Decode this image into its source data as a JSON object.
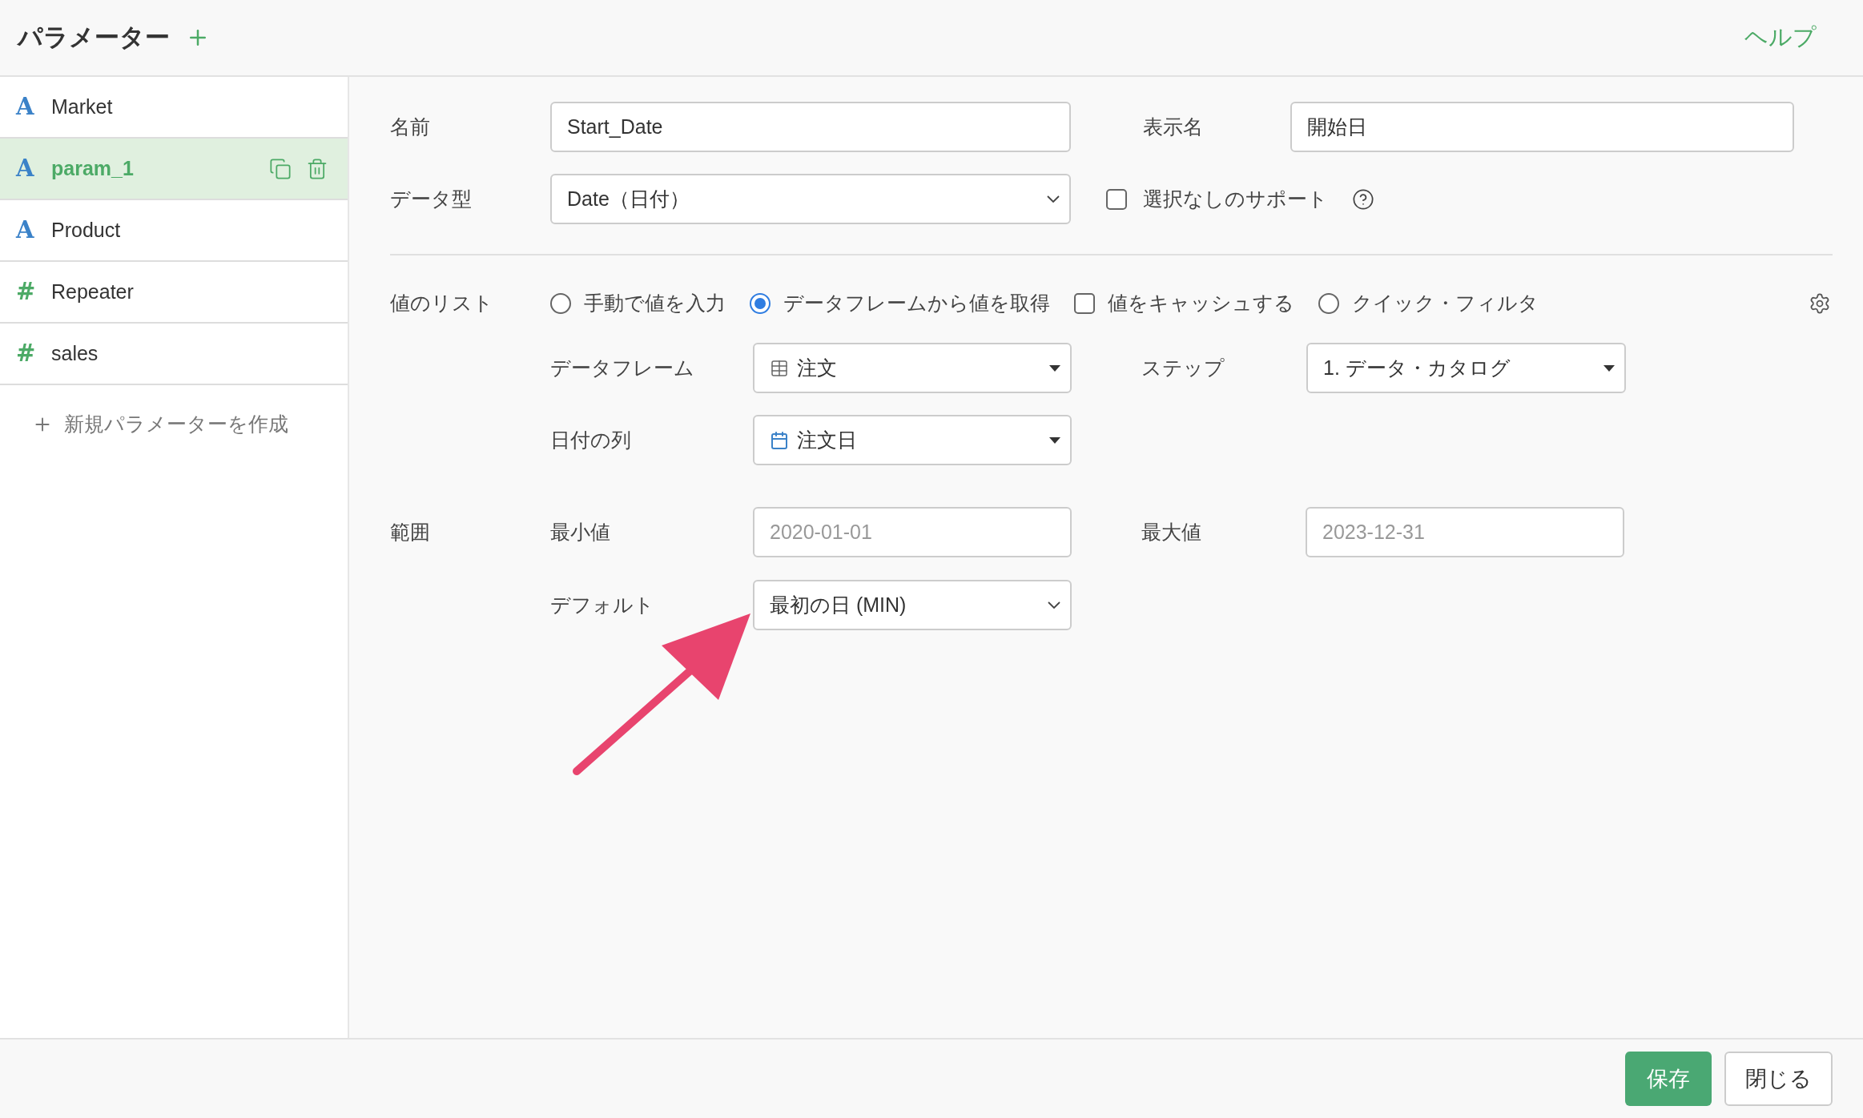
{
  "header": {
    "title": "パラメーター",
    "help": "ヘルプ"
  },
  "sidebar": {
    "items": [
      {
        "kind": "text",
        "icon": "A",
        "name": "Market",
        "selected": false
      },
      {
        "kind": "text",
        "icon": "A",
        "name": "param_1",
        "selected": true
      },
      {
        "kind": "text",
        "icon": "A",
        "name": "Product",
        "selected": false
      },
      {
        "kind": "number",
        "icon": "#",
        "name": "Repeater",
        "selected": false
      },
      {
        "kind": "number",
        "icon": "#",
        "name": "sales",
        "selected": false
      }
    ],
    "create": "新規パラメーターを作成"
  },
  "form": {
    "name": {
      "label": "名前",
      "value": "Start_Date"
    },
    "display_name": {
      "label": "表示名",
      "value": "開始日"
    },
    "data_type": {
      "label": "データ型",
      "value": "Date（日付）"
    },
    "support_none": {
      "label": "選択なしのサポート",
      "checked": false
    },
    "value_list": {
      "label": "値のリスト",
      "options": [
        {
          "kind": "radio",
          "label": "手動で値を入力",
          "selected": false
        },
        {
          "kind": "radio",
          "label": "データフレームから値を取得",
          "selected": true
        },
        {
          "kind": "checkbox",
          "label": "値をキャッシュする",
          "checked": false
        },
        {
          "kind": "radio",
          "label": "クイック・フィルタ",
          "selected": false
        }
      ]
    },
    "dataframe": {
      "label": "データフレーム",
      "value": "注文"
    },
    "step": {
      "label": "ステップ",
      "value": "1. データ・カタログ"
    },
    "date_column": {
      "label": "日付の列",
      "value": "注文日"
    },
    "range": {
      "label": "範囲",
      "min": {
        "label": "最小値",
        "placeholder": "2020-01-01"
      },
      "max": {
        "label": "最大値",
        "placeholder": "2023-12-31"
      },
      "default": {
        "label": "デフォルト",
        "value": "最初の日 (MIN)"
      }
    }
  },
  "footer": {
    "buttons": [
      {
        "kind": "primary",
        "label": "保存"
      },
      {
        "kind": "default",
        "label": "閉じる"
      }
    ]
  }
}
